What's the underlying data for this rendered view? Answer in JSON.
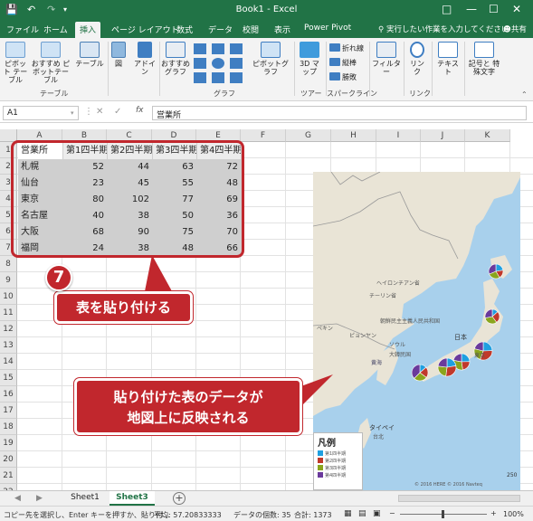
{
  "window": {
    "title": "Book1 - Excel",
    "minimize_icon": "minimize-icon",
    "restore_icon": "restore-icon",
    "close_icon": "close-icon"
  },
  "quick_access": {
    "save_icon": "save-icon",
    "undo_icon": "undo-icon",
    "redo_icon": "redo-icon",
    "customize_icon": "customize-icon"
  },
  "tabs": [
    "ファイル",
    "ホーム",
    "挿入",
    "ページ レイアウト",
    "数式",
    "データ",
    "校閲",
    "表示",
    "Power Pivot"
  ],
  "active_tab": "挿入",
  "tell_me": "実行したい作業を入力してください",
  "share": "共有",
  "ribbon": {
    "pivot": "ピボット テーブル",
    "rec_pivot": "おすすめ ピボットテーブル",
    "table": "テーブル",
    "group_table": "テーブル",
    "illust": "図",
    "addins": "アドイン",
    "rec_chart": "おすすめ グラフ",
    "pivot_chart": "ピボットグラフ",
    "group_chart": "グラフ",
    "map3d": "3D マップ",
    "group_tour": "ツアー",
    "spark_line": "折れ線",
    "spark_column": "縦棒",
    "spark_winloss": "勝敗",
    "group_spark": "スパークライン",
    "filter": "フィルター",
    "link": "リンク",
    "group_link": "リンク",
    "text": "テキスト",
    "symbols": "記号と 特殊文字"
  },
  "formula_bar": {
    "name_box": "A1",
    "fx": "fx",
    "content": "営業所"
  },
  "columns": [
    "A",
    "B",
    "C",
    "D",
    "E",
    "F",
    "G",
    "H",
    "I",
    "J",
    "K"
  ],
  "rows": [
    "1",
    "2",
    "3",
    "4",
    "5",
    "6",
    "7",
    "8",
    "9",
    "10",
    "11",
    "12",
    "13",
    "14",
    "15",
    "16",
    "17",
    "18",
    "19",
    "20",
    "21",
    "22"
  ],
  "sheet_data": {
    "headers": [
      "営業所",
      "第1四半期",
      "第2四半期",
      "第3四半期",
      "第4四半期"
    ],
    "rows": [
      [
        "札幌",
        "52",
        "44",
        "63",
        "72"
      ],
      [
        "仙台",
        "23",
        "45",
        "55",
        "48"
      ],
      [
        "東京",
        "80",
        "102",
        "77",
        "69"
      ],
      [
        "名古屋",
        "40",
        "38",
        "50",
        "36"
      ],
      [
        "大阪",
        "68",
        "90",
        "75",
        "70"
      ],
      [
        "福岡",
        "24",
        "38",
        "48",
        "66"
      ]
    ]
  },
  "map": {
    "labels": {
      "heilongjiang": "ヘイロンチアン省",
      "jilin": "チーリン省",
      "beijing": "ペキン",
      "pyongyang": "ピョンヤン",
      "seoul": "ソウル",
      "daegu": "大韓民国",
      "dprk": "朝鮮民主主義人民共和国",
      "japan": "日本",
      "tokyo": "東京",
      "yellow_sea": "黄海",
      "taipei": "タイペイ",
      "taiwan": "台北"
    },
    "legend": {
      "title": "凡例",
      "items": [
        "第1四半期",
        "第2四半期",
        "第3四半期",
        "第4四半期"
      ]
    },
    "colors": [
      "#1f9fe0",
      "#c0392b",
      "#8aa51d",
      "#6a3a9c"
    ],
    "scale": "250",
    "copyright": "© 2016 HERE © 2016 Navteq"
  },
  "callouts": {
    "step_number": "7",
    "paste_table": "表を貼り付ける",
    "map_note_line1": "貼り付けた表のデータが",
    "map_note_line2": "地図上に反映される"
  },
  "sheets": [
    "Sheet1",
    "Sheet3"
  ],
  "active_sheet": "Sheet3",
  "status": {
    "message": "コピー先を選択し、Enter キーを押すか、貼り付...",
    "average": "平均: 57.20833333",
    "count": "データの個数: 35",
    "sum": "合計: 1373",
    "zoom": "100%"
  }
}
